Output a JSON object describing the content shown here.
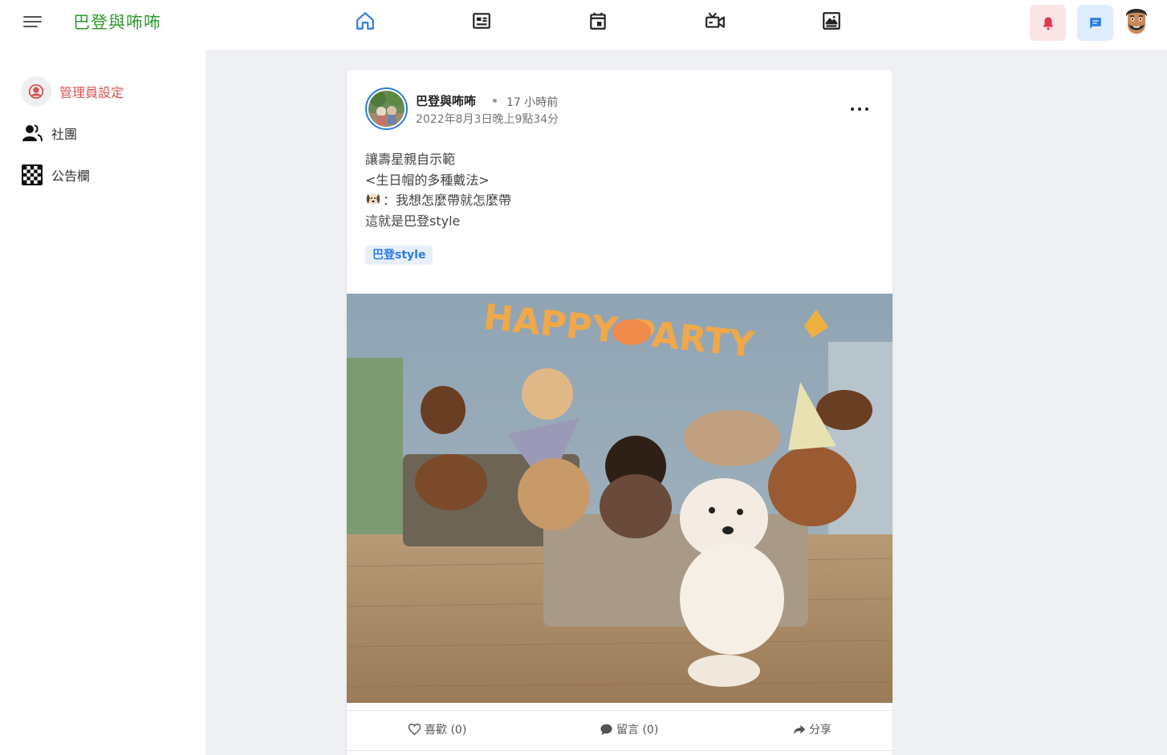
{
  "app": {
    "brand": "巴登與咘咘"
  },
  "topnav": {
    "icons": [
      "home-icon",
      "news-icon",
      "calendar-icon",
      "video-icon",
      "photo-gallery-icon"
    ],
    "active": "home-icon",
    "accent_color": "#2a7be4"
  },
  "actions": {
    "bell_color": "#e0364a",
    "chat_color": "#2a7be4"
  },
  "sidebar": {
    "items": [
      {
        "label": "管理員設定",
        "icon": "user-circle-icon"
      },
      {
        "label": "社團",
        "icon": "group-icon"
      },
      {
        "label": "公告欄",
        "icon": "checkerboard-icon"
      }
    ]
  },
  "post": {
    "author": "巴登與咘咘",
    "relative_time": "17 小時前",
    "timestamp": "2022年8月3日晚上9點34分",
    "lines": [
      "讓壽星親自示範",
      "<生日帽的多種戴法>",
      "：我想怎麼帶就怎麼帶",
      "這就是巴登style"
    ],
    "tag": "巴登style",
    "photo_banner_text": "HAPPY PARTY",
    "actions": {
      "like": "喜歡 (0)",
      "comment": "留言 (0)",
      "share": "分享"
    }
  }
}
